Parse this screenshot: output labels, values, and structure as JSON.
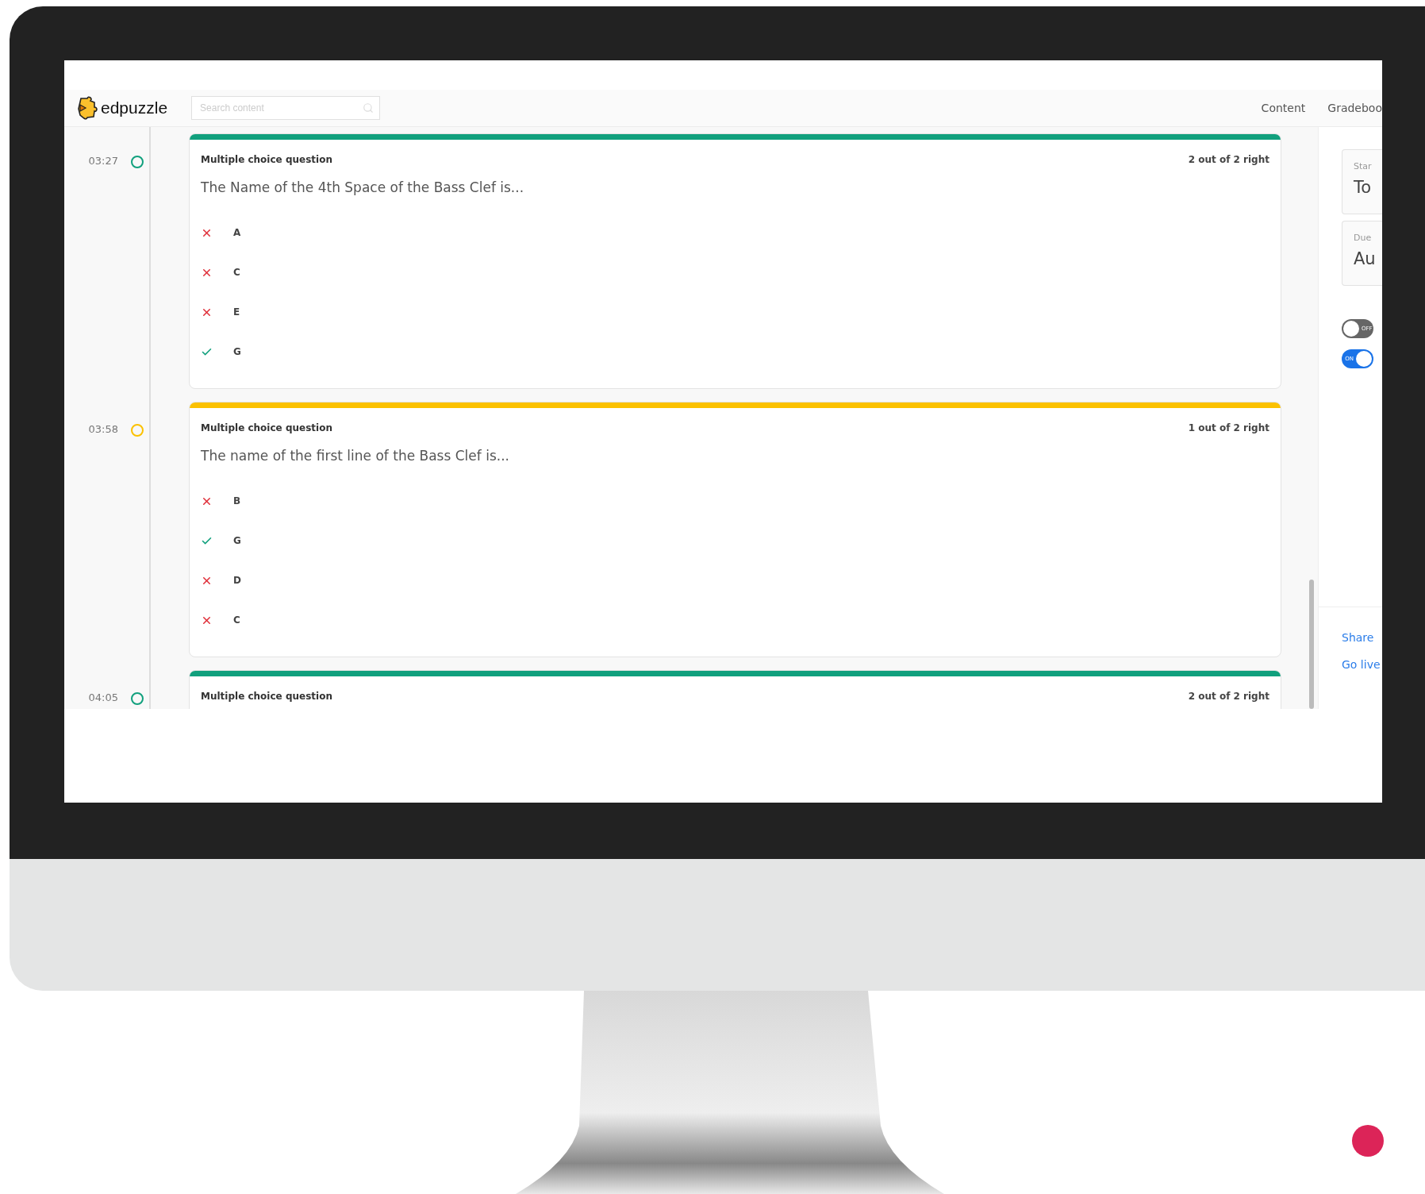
{
  "header": {
    "logo": "edpuzzle",
    "search": {
      "placeholder": "Search content"
    },
    "nav": [
      "Content",
      "Gradeboo"
    ]
  },
  "questions": [
    {
      "time": "03:27",
      "color": "#11a07d",
      "type": "Multiple choice question",
      "score": "2 out of 2 right",
      "text": "The Name of the 4th Space of the Bass Clef is...",
      "answers": [
        {
          "label": "A",
          "correct": false
        },
        {
          "label": "C",
          "correct": false
        },
        {
          "label": "E",
          "correct": false
        },
        {
          "label": "G",
          "correct": true
        }
      ]
    },
    {
      "time": "03:58",
      "color": "#fbc100",
      "type": "Multiple choice question",
      "score": "1 out of 2 right",
      "text": "The name of the first line of the Bass Clef is...",
      "answers": [
        {
          "label": "B",
          "correct": false
        },
        {
          "label": "G",
          "correct": true
        },
        {
          "label": "D",
          "correct": false
        },
        {
          "label": "C",
          "correct": false
        }
      ]
    },
    {
      "time": "04:05",
      "color": "#11a07d",
      "type": "Multiple choice question",
      "score": "2 out of 2 right"
    }
  ],
  "side": {
    "fields": [
      {
        "label": "Star",
        "value": "To"
      },
      {
        "label": "Due",
        "value": "Au"
      }
    ],
    "toggles": [
      {
        "label": "OFF",
        "on": false
      },
      {
        "label": "ON",
        "on": true
      }
    ],
    "links": [
      "Share",
      "Go live"
    ]
  }
}
